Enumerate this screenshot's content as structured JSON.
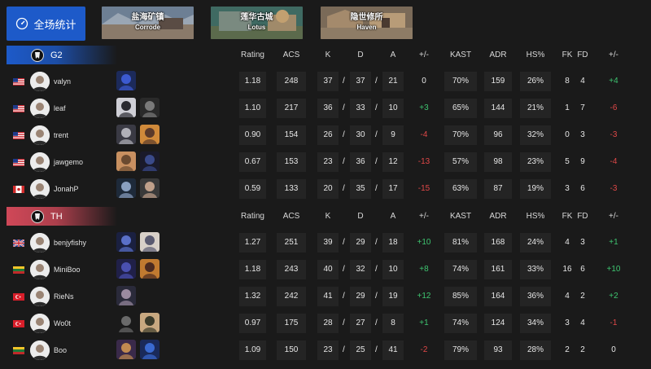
{
  "top": {
    "stat_button": "全场统计",
    "maps": [
      {
        "cn": "盐海矿镇",
        "en": "Corrode"
      },
      {
        "cn": "莲华古城",
        "en": "Lotus"
      },
      {
        "cn": "隐世修所",
        "en": "Haven"
      }
    ]
  },
  "headers": {
    "rating": "Rating",
    "acs": "ACS",
    "k": "K",
    "d": "D",
    "a": "A",
    "kd_diff": "+/-",
    "kast": "KAST",
    "adr": "ADR",
    "hs": "HS%",
    "fk": "FK",
    "fd": "FD",
    "fkfd_diff": "+/-"
  },
  "teams": [
    {
      "name": "G2",
      "accent": "#1d5ac9",
      "players": [
        {
          "flag": "us",
          "name": "valyn",
          "agents": [
            "agent-a"
          ],
          "rating": "1.18",
          "acs": "248",
          "k": "37",
          "d": "37",
          "a": "21",
          "kd": "0",
          "kd_sign": "neu",
          "kast": "70%",
          "adr": "159",
          "hs": "26%",
          "fk": "8",
          "fd": "4",
          "fkfd": "+4",
          "fkfd_sign": "pos"
        },
        {
          "flag": "us",
          "name": "leaf",
          "agents": [
            "agent-b",
            "agent-c"
          ],
          "rating": "1.10",
          "acs": "217",
          "k": "36",
          "d": "33",
          "a": "10",
          "kd": "+3",
          "kd_sign": "pos",
          "kast": "65%",
          "adr": "144",
          "hs": "21%",
          "fk": "1",
          "fd": "7",
          "fkfd": "-6",
          "fkfd_sign": "neg"
        },
        {
          "flag": "us",
          "name": "trent",
          "agents": [
            "agent-d",
            "agent-e"
          ],
          "rating": "0.90",
          "acs": "154",
          "k": "26",
          "d": "30",
          "a": "9",
          "kd": "-4",
          "kd_sign": "neg",
          "kast": "70%",
          "adr": "96",
          "hs": "32%",
          "fk": "0",
          "fd": "3",
          "fkfd": "-3",
          "fkfd_sign": "neg"
        },
        {
          "flag": "us",
          "name": "jawgemo",
          "agents": [
            "agent-f",
            "agent-g"
          ],
          "rating": "0.67",
          "acs": "153",
          "k": "23",
          "d": "36",
          "a": "12",
          "kd": "-13",
          "kd_sign": "neg",
          "kast": "57%",
          "adr": "98",
          "hs": "23%",
          "fk": "5",
          "fd": "9",
          "fkfd": "-4",
          "fkfd_sign": "neg"
        },
        {
          "flag": "ca",
          "name": "JonahP",
          "agents": [
            "agent-h",
            "agent-i"
          ],
          "rating": "0.59",
          "acs": "133",
          "k": "20",
          "d": "35",
          "a": "17",
          "kd": "-15",
          "kd_sign": "neg",
          "kast": "63%",
          "adr": "87",
          "hs": "19%",
          "fk": "3",
          "fd": "6",
          "fkfd": "-3",
          "fkfd_sign": "neg"
        }
      ]
    },
    {
      "name": "TH",
      "accent": "#d04858",
      "players": [
        {
          "flag": "gb",
          "name": "benjyfishy",
          "agents": [
            "agent-j",
            "agent-k"
          ],
          "rating": "1.27",
          "acs": "251",
          "k": "39",
          "d": "29",
          "a": "18",
          "kd": "+10",
          "kd_sign": "pos",
          "kast": "81%",
          "adr": "168",
          "hs": "24%",
          "fk": "4",
          "fd": "3",
          "fkfd": "+1",
          "fkfd_sign": "pos"
        },
        {
          "flag": "lt",
          "name": "MiniBoo",
          "agents": [
            "agent-l",
            "agent-m"
          ],
          "rating": "1.18",
          "acs": "243",
          "k": "40",
          "d": "32",
          "a": "10",
          "kd": "+8",
          "kd_sign": "pos",
          "kast": "74%",
          "adr": "161",
          "hs": "33%",
          "fk": "16",
          "fd": "6",
          "fkfd": "+10",
          "fkfd_sign": "pos"
        },
        {
          "flag": "tr",
          "name": "RieNs",
          "agents": [
            "agent-n"
          ],
          "rating": "1.32",
          "acs": "242",
          "k": "41",
          "d": "29",
          "a": "19",
          "kd": "+12",
          "kd_sign": "pos",
          "kast": "85%",
          "adr": "164",
          "hs": "36%",
          "fk": "4",
          "fd": "2",
          "fkfd": "+2",
          "fkfd_sign": "pos"
        },
        {
          "flag": "tr",
          "name": "Wo0t",
          "agents": [
            "agent-o",
            "agent-p"
          ],
          "rating": "0.97",
          "acs": "175",
          "k": "28",
          "d": "27",
          "a": "8",
          "kd": "+1",
          "kd_sign": "pos",
          "kast": "74%",
          "adr": "124",
          "hs": "34%",
          "fk": "3",
          "fd": "4",
          "fkfd": "-1",
          "fkfd_sign": "neg"
        },
        {
          "flag": "lt",
          "name": "Boo",
          "agents": [
            "agent-q",
            "agent-r"
          ],
          "rating": "1.09",
          "acs": "150",
          "k": "23",
          "d": "25",
          "a": "41",
          "kd": "-2",
          "kd_sign": "neg",
          "kast": "79%",
          "adr": "93",
          "hs": "28%",
          "fk": "2",
          "fd": "2",
          "fkfd": "0",
          "fkfd_sign": "neu"
        }
      ]
    }
  ]
}
